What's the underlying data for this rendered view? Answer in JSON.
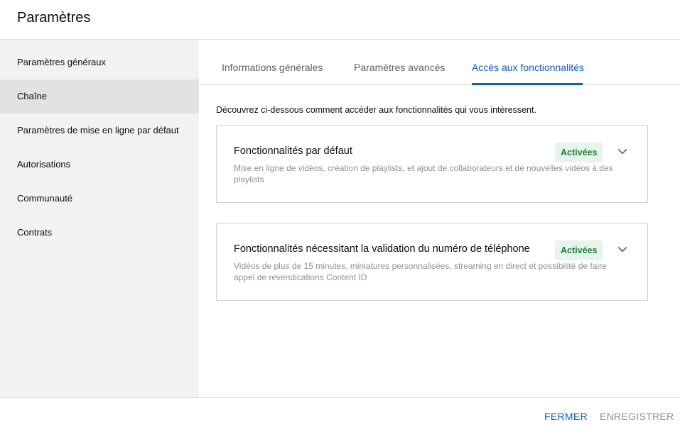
{
  "header": {
    "title": "Paramètres"
  },
  "sidebar": {
    "items": [
      {
        "label": "Paramètres généraux"
      },
      {
        "label": "Chaîne"
      },
      {
        "label": "Paramètres de mise en ligne par défaut"
      },
      {
        "label": "Autorisations"
      },
      {
        "label": "Communauté"
      },
      {
        "label": "Contrats"
      }
    ],
    "active_index": 1
  },
  "tabs": [
    {
      "label": "Informations générales"
    },
    {
      "label": "Paramètres avancés"
    },
    {
      "label": "Accès aux fonctionnalités"
    }
  ],
  "active_tab_index": 2,
  "intro": "Découvrez ci-dessous comment accéder aux fonctionnalités qui vous intéressent.",
  "cards": [
    {
      "title": "Fonctionnalités par défaut",
      "description": "Mise en ligne de vidéos, création de playlists, et ajout de collaborateurs et de nouvelles vidéos à des playlists",
      "badge": "Activées",
      "icon": "chevron-down-icon"
    },
    {
      "title": "Fonctionnalités nécessitant la validation du numéro de téléphone",
      "description": "Vidéos de plus de 15 minutes, miniatures personnalisées, streaming en direct et possibilité de faire appel de revendications Content ID",
      "badge": "Activées",
      "icon": "chevron-down-icon"
    }
  ],
  "footer": {
    "close_label": "FERMER",
    "save_label": "ENREGISTRER"
  },
  "colors": {
    "accent": "#065fd4",
    "badge_bg": "#e6f4ea",
    "badge_text": "#188038",
    "sidebar_bg": "#f2f2f2",
    "sidebar_active_bg": "#e2e2e2"
  }
}
